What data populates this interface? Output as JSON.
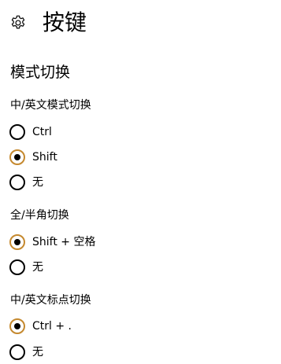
{
  "header": {
    "icon": "gear-icon",
    "title": "按键"
  },
  "section": {
    "title": "模式切换"
  },
  "groups": [
    {
      "label": "中/英文模式切换",
      "options": [
        {
          "label": "Ctrl",
          "checked": false
        },
        {
          "label": "Shift",
          "checked": true
        },
        {
          "label": "无",
          "checked": false
        }
      ]
    },
    {
      "label": "全/半角切换",
      "options": [
        {
          "label": "Shift + 空格",
          "checked": true
        },
        {
          "label": "无",
          "checked": false
        }
      ]
    },
    {
      "label": "中/英文标点切换",
      "options": [
        {
          "label": "Ctrl + .",
          "checked": true
        },
        {
          "label": "无",
          "checked": false
        }
      ]
    }
  ],
  "colors": {
    "accent": "#c5892f",
    "text": "#000000",
    "background": "#ffffff"
  }
}
